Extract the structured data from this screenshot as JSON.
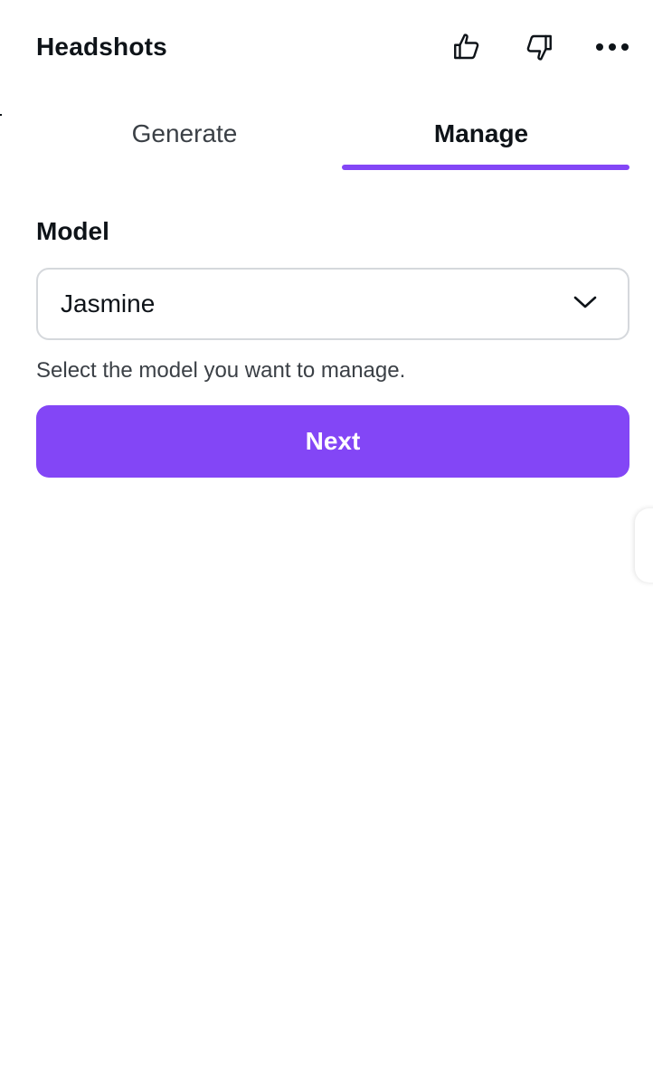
{
  "header": {
    "title": "Headshots",
    "icons": [
      "thumbs-up-icon",
      "thumbs-down-icon",
      "more-options-icon"
    ]
  },
  "tabs": [
    {
      "label": "Generate",
      "active": false
    },
    {
      "label": "Manage",
      "active": true
    }
  ],
  "form": {
    "model_label": "Model",
    "model_selected": "Jasmine",
    "helper_text": "Select the model you want to manage.",
    "next_label": "Next"
  },
  "colors": {
    "accent": "#8346f6",
    "text": "#0e1318",
    "border": "#d5d8dc"
  }
}
